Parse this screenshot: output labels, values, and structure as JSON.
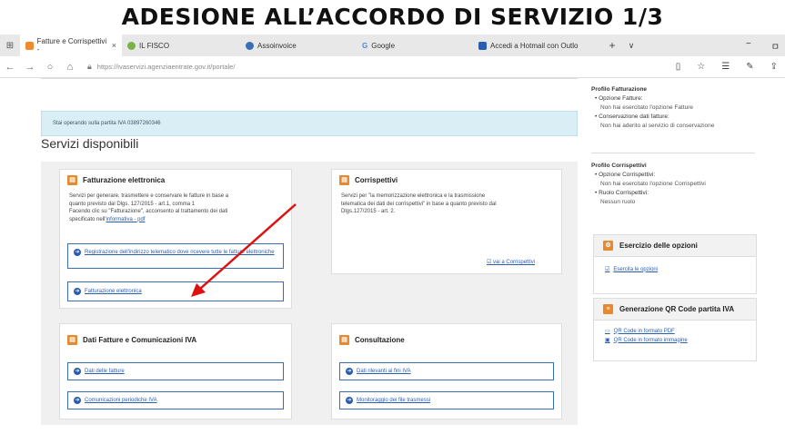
{
  "slide_title": "ADESIONE ALL’ACCORDO DI SERVIZIO 1/3",
  "browser": {
    "tabs": [
      {
        "label": "Fatture e Corrispettivi -",
        "color": "#f28a2e",
        "active": true
      },
      {
        "label": "IL FISCO",
        "color": "#7bb243"
      },
      {
        "label": "Assoinvoice",
        "color": "#3a6fb8"
      },
      {
        "label": "Google",
        "color": "#4a86e8"
      },
      {
        "label": "Accedi a Hotmail con Outlo",
        "color": "#2a5db0"
      }
    ],
    "close_tab": "×",
    "new_tab": "+",
    "tab_menu": "∨",
    "url": "https://ivaservizi.agenziaentrate.gov.it/portale/",
    "win_controls": [
      "−",
      "ㅁ"
    ]
  },
  "page": {
    "alert_text": "Stai operando sulla partita IVA 03897260346",
    "section_title": "Servizi disponibili",
    "cards": {
      "fatturazione": {
        "title": "Fatturazione elettronica",
        "text_lines": [
          "Servizi per generare, trasmettere e conservare le fatture in base a",
          "quanto previsto dal Dlgs. 127/2015 - art.1, comma 1",
          "Facendo clic su \"Fatturazione\", acconsento al trattamento dei dati",
          "specificato nell'"
        ],
        "info_link": "informativa - pdf",
        "btn_registrazione": "Registrazione dell'indirizzo telematico dove ricevere tutte le fatture elettroniche",
        "btn_fatturazione": "Fatturazione elettronica"
      },
      "corrispettivi": {
        "title": "Corrispettivi",
        "text_lines": [
          "Servizi per \"la memorizzazione elettronica e la trasmissione",
          "telematica dei dati dei corrispettivi\" in base a quanto previsto dal",
          "Dlgs.127/2015 - art. 2."
        ],
        "link": "vai a Corrispettivi"
      },
      "dati_fatture": {
        "title": "Dati Fatture e Comunicazioni IVA",
        "btn_dati": "Dati delle fatture",
        "btn_comunicazioni": "Comunicazioni periodiche IVA"
      },
      "consultazione": {
        "title": "Consultazione",
        "btn_dati_rilevanti": "Dati rilevanti ai fini IVA",
        "btn_monitoraggio": "Monitoraggio dei file trasmessi"
      }
    },
    "sidebar": {
      "profilo_fatturazione": {
        "heading": "Profilo Fatturazione",
        "items": [
          {
            "label": "Opzione Fatture:",
            "value": "Non hai esercitato l'opzione Fatture"
          },
          {
            "label": "Conservazione dati fatture:",
            "value": "Non hai aderito al servizio di conservazione"
          }
        ]
      },
      "profilo_corrispettivi": {
        "heading": "Profilo Corrispettivi",
        "items": [
          {
            "label": "Opzione Corrispettivi:",
            "value": "Non hai esercitato l'opzione Corrispettivi"
          },
          {
            "label": "Ruolo Corrispettivi:",
            "value": "Nessun ruolo"
          }
        ]
      },
      "esercizio": {
        "title": "Esercizio delle opzioni",
        "link": "Esercita le opzioni"
      },
      "qr": {
        "title": "Generazione QR Code partita IVA",
        "link_pdf": "QR Code in formato PDF",
        "link_img": "QR Code in formato immagine"
      }
    }
  }
}
